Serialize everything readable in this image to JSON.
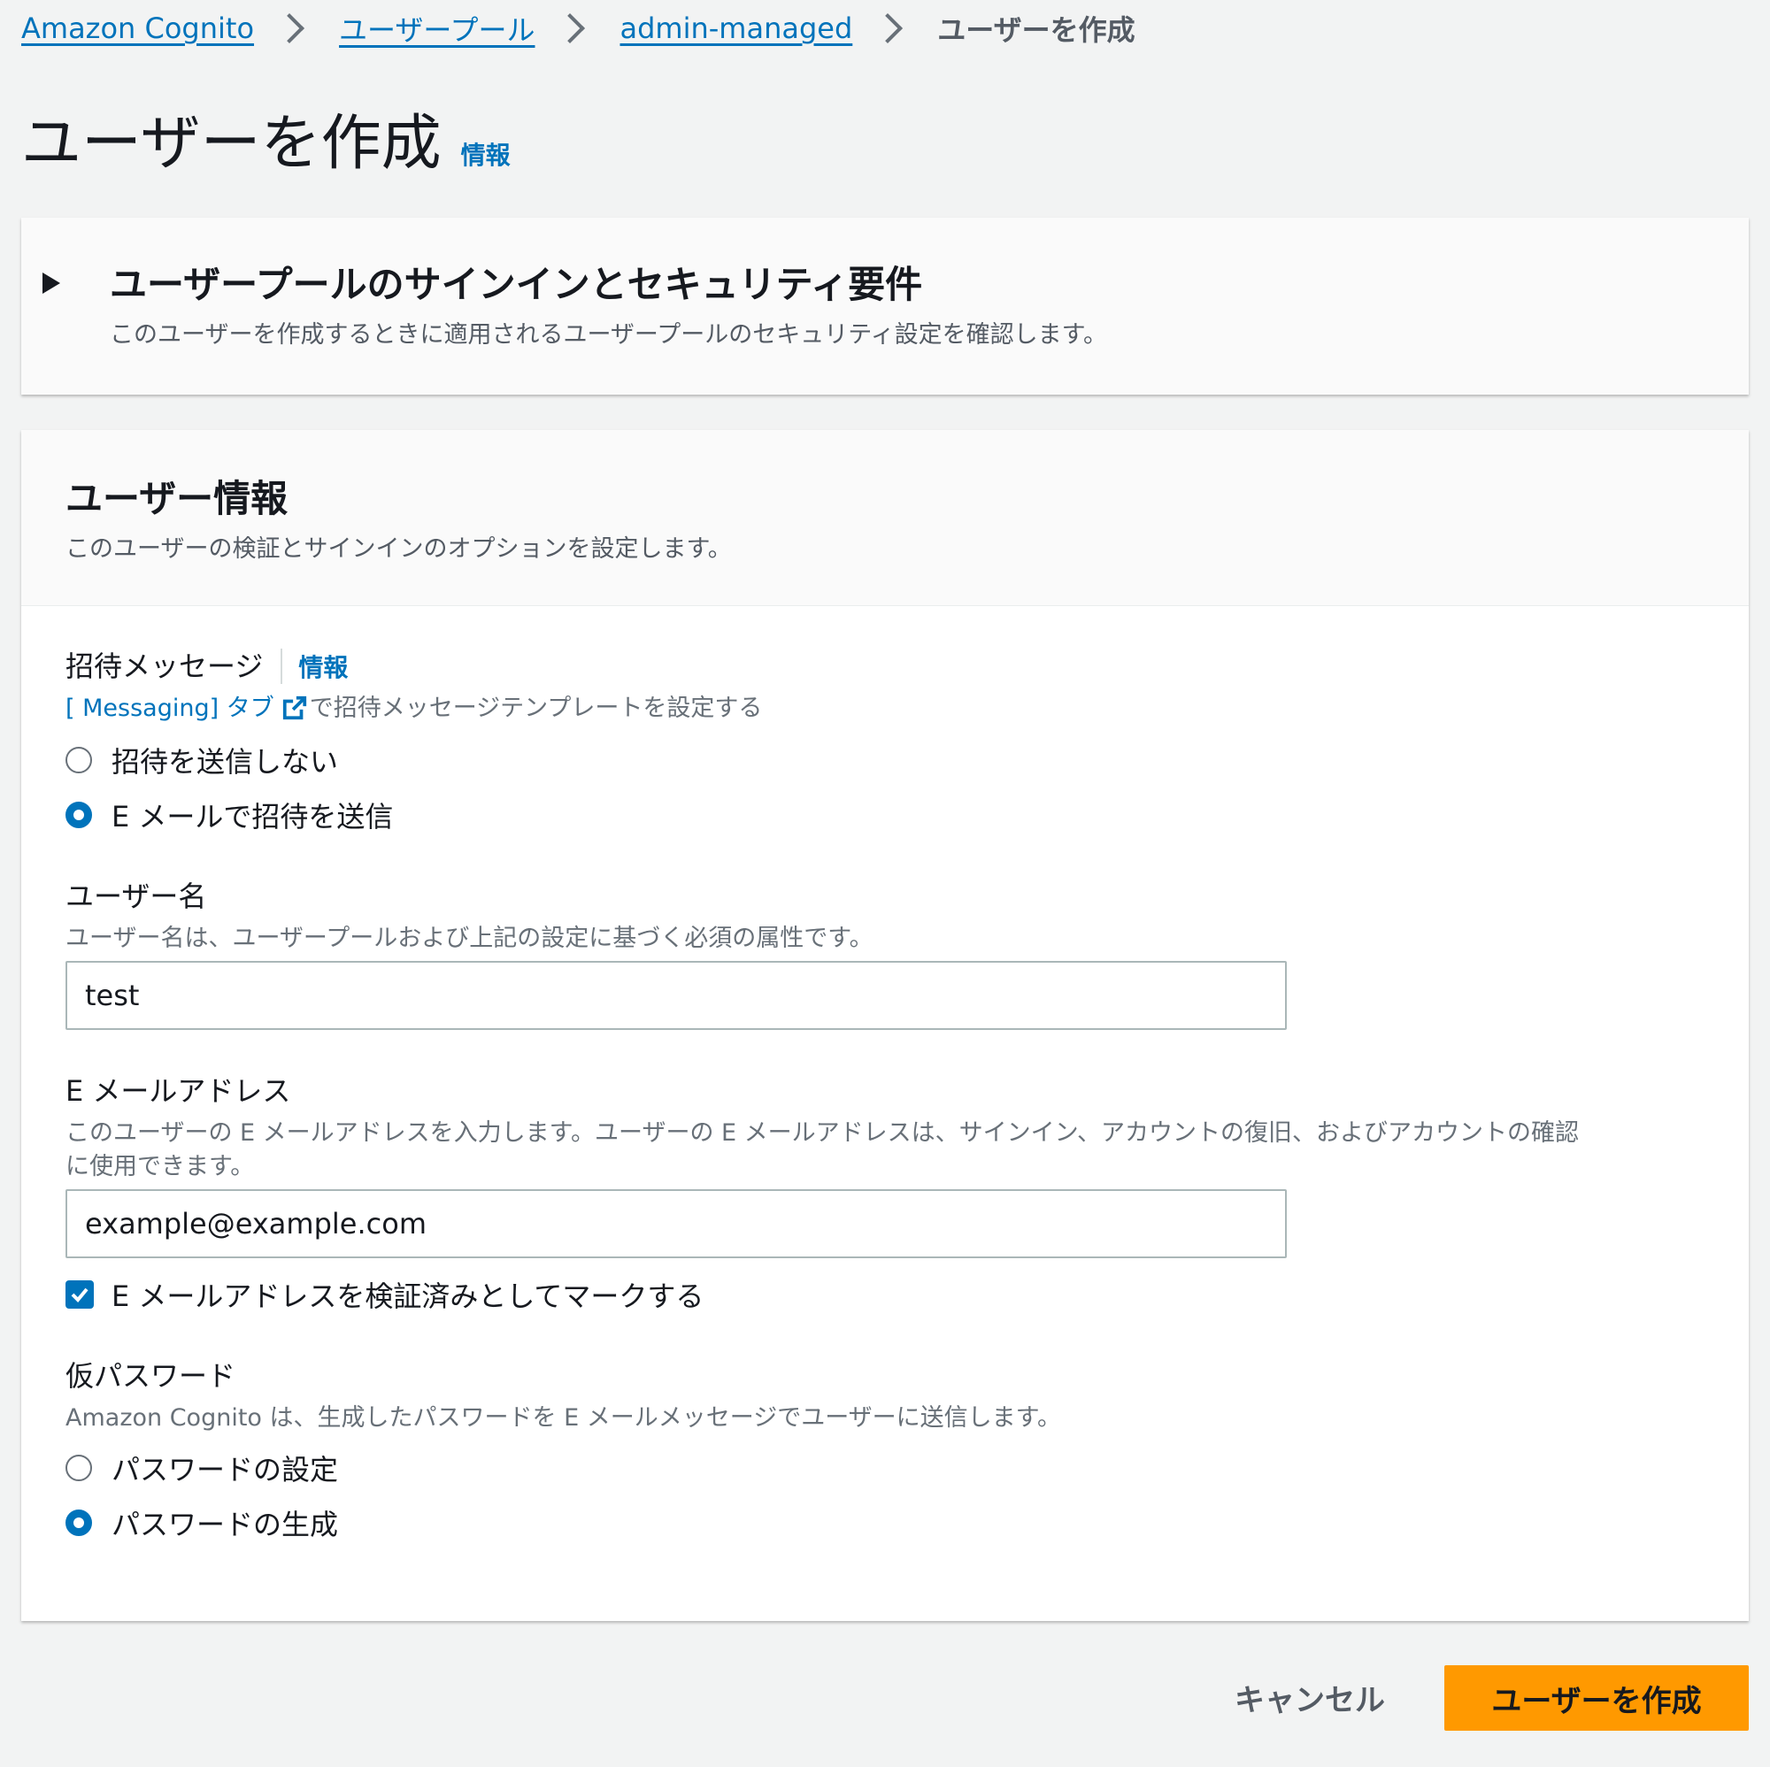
{
  "breadcrumb": {
    "items": [
      "Amazon Cognito",
      "ユーザープール",
      "admin-managed"
    ],
    "current": "ユーザーを作成"
  },
  "page": {
    "title": "ユーザーを作成",
    "info": "情報"
  },
  "security_section": {
    "title": "ユーザープールのサインインとセキュリティ要件",
    "description": "このユーザーを作成するときに適用されるユーザープールのセキュリティ設定を確認します。"
  },
  "user_info": {
    "title": "ユーザー情報",
    "description": "このユーザーの検証とサインインのオプションを設定します。",
    "invitation": {
      "label": "招待メッセージ",
      "info": "情報",
      "link_prefix": "[ ",
      "link_text": "Messaging] タブ",
      "link_suffix": "で招待メッセージテンプレートを設定する",
      "options": [
        "招待を送信しない",
        "E メールで招待を送信"
      ],
      "selected": 1
    },
    "username": {
      "label": "ユーザー名",
      "hint": "ユーザー名は、ユーザープールおよび上記の設定に基づく必須の属性です。",
      "value": "test"
    },
    "email": {
      "label": "E メールアドレス",
      "hint_line1": "このユーザーの E メールアドレスを入力します。ユーザーの E メールアドレスは、サインイン、アカウントの復旧、およびアカウントの確認",
      "hint_line2": "に使用できます。",
      "value": "example@example.com",
      "verified_label": "E メールアドレスを検証済みとしてマークする",
      "verified": true
    },
    "temp_password": {
      "label": "仮パスワード",
      "hint": "Amazon Cognito は、生成したパスワードを E メールメッセージでユーザーに送信します。",
      "options": [
        "パスワードの設定",
        "パスワードの生成"
      ],
      "selected": 1
    }
  },
  "actions": {
    "cancel": "キャンセル",
    "create": "ユーザーを作成"
  },
  "colors": {
    "link": "#0073bb",
    "primary_button": "#ff9900",
    "background": "#f2f3f3"
  }
}
